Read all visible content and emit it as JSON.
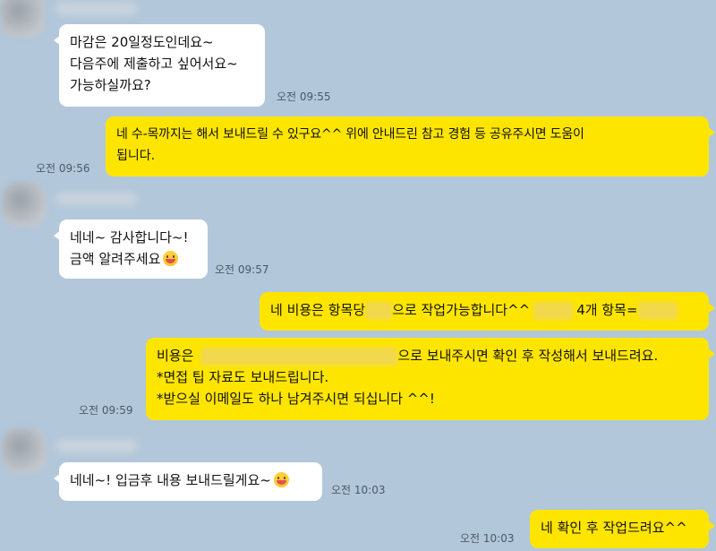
{
  "messages": [
    {
      "side": "in",
      "lines": [
        "마감은 20일정도인데요~",
        "다음주에 제출하고 싶어서요~",
        "가능하실까요?"
      ],
      "time": "오전 09:55"
    },
    {
      "side": "out",
      "lines": [
        "네 수-목까지는 해서 보내드릴 수 있구요^^ 위에 안내드린 참고 경험 등 공유주시면 도움이",
        "됩니다."
      ],
      "time": "오전 09:56"
    },
    {
      "side": "in",
      "lines": [
        "네네~ 감사합니다~!",
        "금액 알려주세요"
      ],
      "time": "오전 09:57"
    },
    {
      "side": "out",
      "parts": [
        "네 비용은 항목당",
        "으로 작업가능합니다^^",
        "4개 항목="
      ],
      "time": ""
    },
    {
      "side": "out",
      "line1_parts": [
        "비용은",
        "으로 보내주시면 확인 후 작성해서 보내드려요."
      ],
      "lines": [
        "*면접 팁 자료도 보내드립니다.",
        "*받으실 이메일도 하나 남겨주시면 되십니다 ^^!"
      ],
      "time": "오전 09:59"
    },
    {
      "side": "in",
      "lines": [
        "네네~! 입금후 내용 보내드릴게요~"
      ],
      "time": "오전 10:03"
    },
    {
      "side": "out",
      "lines": [
        "네 확인 후 작업드려요^^"
      ],
      "time": "오전 10:03"
    }
  ],
  "colors": {
    "background": "#b2c7da",
    "incoming_bubble": "#ffffff",
    "outgoing_bubble": "#fee500"
  },
  "icons": {
    "emoji": "grinning-face-emoji"
  }
}
